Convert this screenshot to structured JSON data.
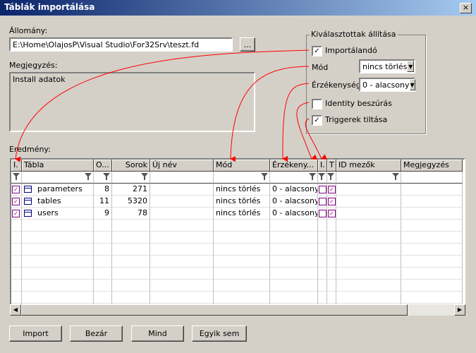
{
  "window": {
    "title": "Táblák importálása",
    "close_glyph": "×"
  },
  "file": {
    "label": "Állomány:",
    "value": "E:\\Home\\OlajosP\\Visual Studio\\For32Srv\\teszt.fd",
    "browse_label": "..."
  },
  "note": {
    "label": "Megjegyzés:",
    "value": "Install adatok"
  },
  "selected_settings": {
    "title": "Kiválasztottak állítása",
    "importable": {
      "label": "Importálandó",
      "checked": true
    },
    "mode": {
      "label": "Mód",
      "value": "nincs törlés"
    },
    "sensitivity": {
      "label": "Érzékenység",
      "value": "0 - alacsony"
    },
    "identity": {
      "label": "Identity beszúrás",
      "checked": false
    },
    "triggers": {
      "label": "Triggerek tiltása",
      "checked": true
    }
  },
  "result": {
    "label": "Eredmény:",
    "columns": [
      "I.",
      "Tábla",
      "O...",
      "Sorok",
      "Új név",
      "Mód",
      "Érzékeny...",
      "I.",
      "T",
      "ID mezők",
      "Megjegyzés"
    ],
    "rows": [
      {
        "import": "☑",
        "table": "parameters",
        "order": "8",
        "rows": "271",
        "new_name": "",
        "mode": "nincs törlés",
        "sensitivity": "0 - alacsony",
        "identity": "☐",
        "trigger": "☑",
        "id_fields": "",
        "note": ""
      },
      {
        "import": "☑",
        "table": "tables",
        "order": "11",
        "rows": "5320",
        "new_name": "",
        "mode": "nincs törlés",
        "sensitivity": "0 - alacsony",
        "identity": "☐",
        "trigger": "☑",
        "id_fields": "",
        "note": ""
      },
      {
        "import": "☑",
        "table": "users",
        "order": "9",
        "rows": "78",
        "new_name": "",
        "mode": "nincs törlés",
        "sensitivity": "0 - alacsony",
        "identity": "☐",
        "trigger": "☑",
        "id_fields": "",
        "note": ""
      }
    ]
  },
  "buttons": {
    "import": "Import",
    "close": "Bezár",
    "all": "Mind",
    "none": "Egyik sem"
  },
  "colors": {
    "arrow": "#ff0000",
    "title_start": "#0a246a",
    "title_end": "#a6caf0"
  }
}
